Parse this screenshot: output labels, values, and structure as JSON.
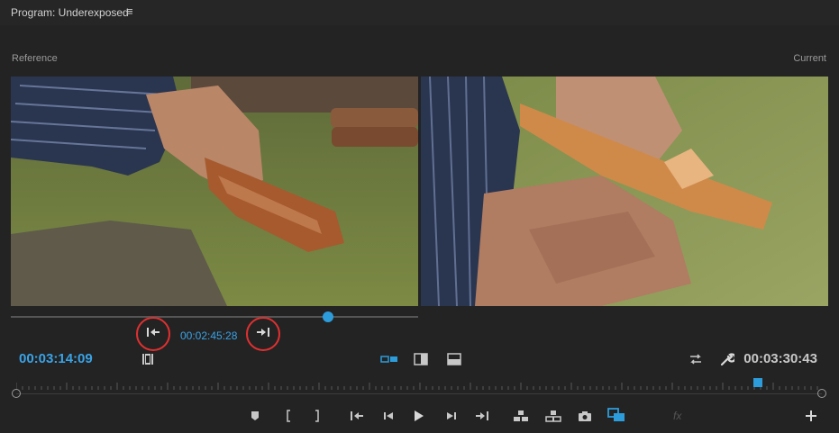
{
  "panel": {
    "title": "Program: Underexposed",
    "menu_glyph": "≡"
  },
  "labels": {
    "reference": "Reference",
    "current": "Current"
  },
  "timecodes": {
    "reference": "00:02:45:28",
    "current_position": "00:03:14:09",
    "duration": "00:03:30:43"
  },
  "reference_scrub_position": 0.79,
  "timeline_playhead_position": 0.92,
  "toolbar": {
    "fx_label": "fx",
    "buttons": [
      "add-marker",
      "mark-in",
      "mark-out",
      "go-to-in",
      "step-back",
      "play",
      "step-forward",
      "go-to-out",
      "lift",
      "extract",
      "export-frame",
      "comparison-view",
      "insert-effects",
      "add-button"
    ]
  },
  "colors": {
    "accent": "#2d9cdb",
    "timecode_blue": "#3aa3e6",
    "highlight_circle": "#e03030",
    "background": "#232323"
  }
}
